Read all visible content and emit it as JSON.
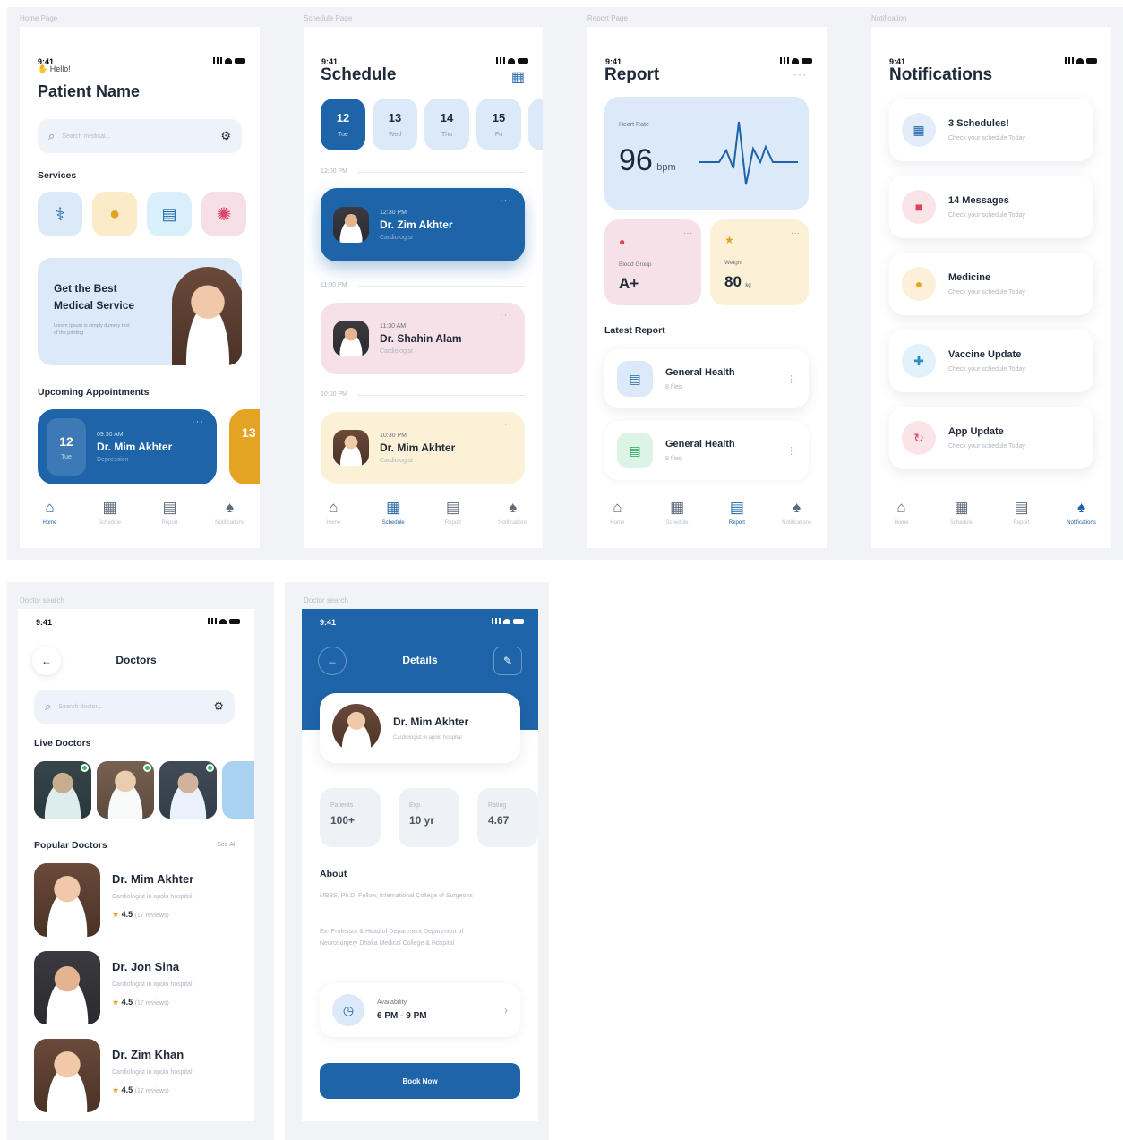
{
  "boards": {
    "home": "Home Page",
    "schedule": "Schedule Page",
    "report": "Report Page",
    "notifications": "Notification",
    "doctor_search": "Doctor search",
    "doctor_details": "Doctor search"
  },
  "status_time": "9:41",
  "nav": {
    "home": "Home",
    "schedule": "Schedule",
    "report": "Report",
    "notifications": "Notifications"
  },
  "home": {
    "greeting": "Hello!",
    "name": "Patient Name",
    "search_placeholder": "Search medical...",
    "services_title": "Services",
    "banner": {
      "title_line1": "Get the Best",
      "title_line2": "Medical Service",
      "body": "Lorem Ipsum is simply dummy text of the printing"
    },
    "upcoming_title": "Upcoming Appointments",
    "appointment": {
      "day": "12",
      "weekday": "Tue",
      "time": "09:30 AM",
      "doctor": "Dr. Mim Akhter",
      "specialty": "Depression"
    },
    "appointment2_day": "13"
  },
  "schedule": {
    "title": "Schedule",
    "days": [
      {
        "num": "12",
        "wd": "Tue"
      },
      {
        "num": "13",
        "wd": "Wed"
      },
      {
        "num": "14",
        "wd": "Thu"
      },
      {
        "num": "15",
        "wd": "Fri"
      }
    ],
    "slots": [
      {
        "label": "12:00 PM",
        "time": "12:30 PM",
        "doctor": "Dr. Zim Akhter",
        "specialty": "Cardiologist"
      },
      {
        "label": "11:00 PM",
        "time": "11:30 AM",
        "doctor": "Dr. Shahin Alam",
        "specialty": "Cardiologist"
      },
      {
        "label": "10:00 PM",
        "time": "10:30 PM",
        "doctor": "Dr. Mim Akhter",
        "specialty": "Cardiologist"
      }
    ]
  },
  "report": {
    "title": "Report",
    "heart_label": "Heart Rate",
    "heart_value": "96",
    "heart_unit": "bpm",
    "blood_label": "Blood Group",
    "blood_value": "A+",
    "weight_label": "Weight",
    "weight_value": "80",
    "weight_unit": "kg",
    "latest_title": "Latest Report",
    "items": [
      {
        "title": "General Health",
        "sub": "8 files"
      },
      {
        "title": "General Health",
        "sub": "8 files"
      }
    ]
  },
  "notifications": {
    "title": "Notifications",
    "sub": "Check your schedule Today",
    "items": [
      {
        "title": "3 Schedules!",
        "icon": "calendar-icon",
        "color": "#1e64a8",
        "bg": "#e3edf9"
      },
      {
        "title": "14 Messages",
        "icon": "message-icon",
        "color": "#e0405a",
        "bg": "#fbe4e8"
      },
      {
        "title": "Medicine",
        "icon": "pill-icon",
        "color": "#e5a323",
        "bg": "#fdf0d8"
      },
      {
        "title": "Vaccine Update",
        "icon": "vaccine-icon",
        "color": "#2a8fbf",
        "bg": "#e1f2fa"
      },
      {
        "title": "App Update",
        "icon": "update-icon",
        "color": "#e0405a",
        "bg": "#fbe4e8"
      }
    ]
  },
  "doctors": {
    "title": "Doctors",
    "search_placeholder": "Search doctor...",
    "live_title": "Live Doctors",
    "popular_title": "Popular Doctors",
    "see_all": "See All",
    "list": [
      {
        "name": "Dr. Mim Akhter",
        "spec": "Cardiologist in apolo hospital",
        "rating": "4.5",
        "reviews": "(17 reviews)"
      },
      {
        "name": "Dr. Jon Sina",
        "spec": "Cardiologist in apolo hospital",
        "rating": "4.5",
        "reviews": "(17 reviews)"
      },
      {
        "name": "Dr. Zim Khan",
        "spec": "Cardiologist in apolo hospital",
        "rating": "4.5",
        "reviews": "(17 reviews)"
      }
    ]
  },
  "details": {
    "title": "Details",
    "doctor": "Dr. Mim Akhter",
    "spec": "Cardiologist in apolo hospital",
    "stats": [
      {
        "label": "Patients",
        "value": "100+"
      },
      {
        "label": "Exp.",
        "value": "10 yr"
      },
      {
        "label": "Rating",
        "value": "4.67"
      }
    ],
    "about_title": "About",
    "about_1": "MBBS, Ph.D, Fellow, International College of Surgeons",
    "about_2": "Ex- Professor & Head of Department Department of Neurosurgery Dhaka Medical College & Hospital",
    "availability_label": "Availability",
    "availability_value": "6 PM - 9 PM",
    "book": "Book Now"
  },
  "colors": {
    "primary": "#1e64a8",
    "light_blue": "#dbe9f8",
    "pink": "#f6e1e8",
    "yellow": "#fcf0d6"
  }
}
